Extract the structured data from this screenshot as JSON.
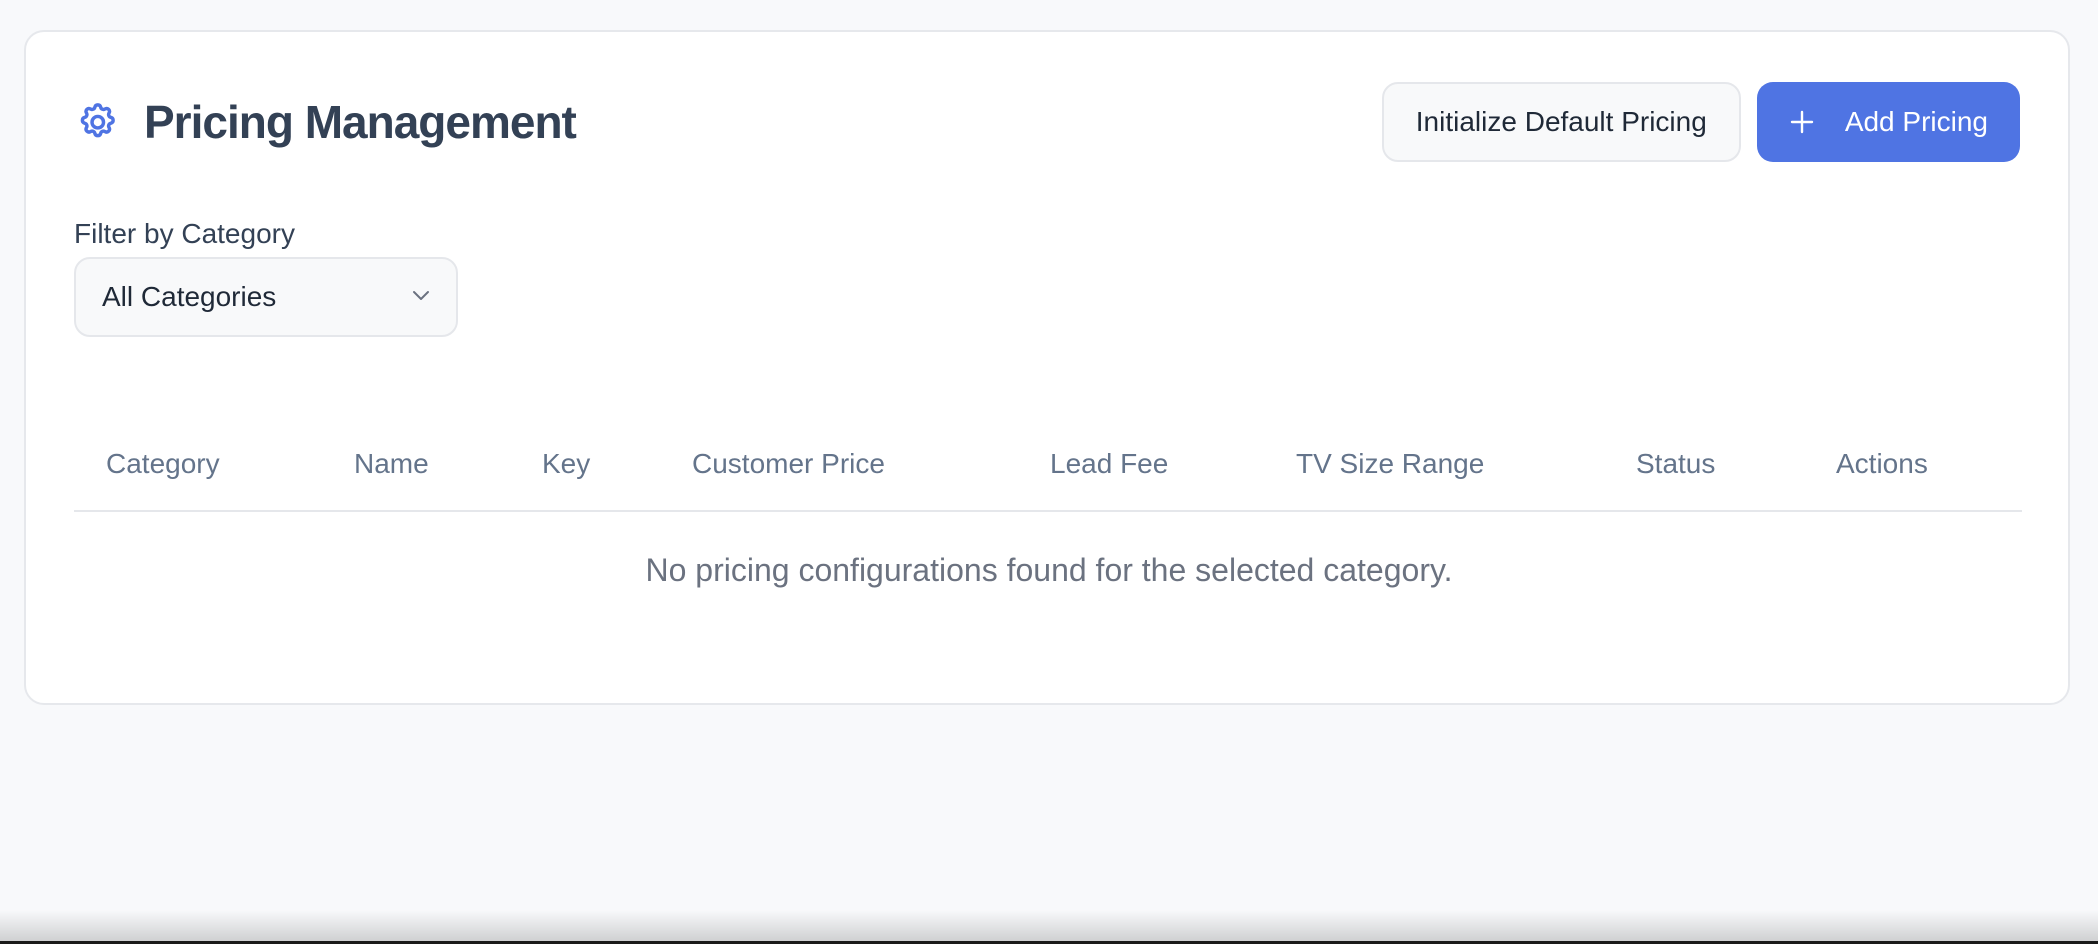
{
  "header": {
    "title": "Pricing Management",
    "icon": "gear-icon",
    "init_button_label": "Initialize Default Pricing",
    "add_button_label": "Add Pricing",
    "add_button_icon": "plus-icon"
  },
  "filter": {
    "label": "Filter by Category",
    "selected": "All Categories",
    "icon": "chevron-down-icon"
  },
  "table": {
    "columns": [
      "Category",
      "Name",
      "Key",
      "Customer Price",
      "Lead Fee",
      "TV Size Range",
      "Status",
      "Actions"
    ],
    "empty_message": "No pricing configurations found for the selected category."
  },
  "colors": {
    "accent": "#4f74e3",
    "background": "#f8f9fb",
    "card": "#ffffff",
    "title": "#334155",
    "muted": "#64748b"
  }
}
